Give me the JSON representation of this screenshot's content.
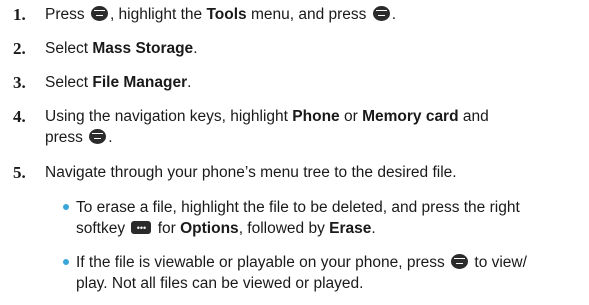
{
  "steps": [
    {
      "num": "1.",
      "a": "Press ",
      "b": ", highlight the ",
      "c": "Tools",
      "d": " menu, and press ",
      "e": "."
    },
    {
      "num": "2.",
      "a": "Select ",
      "b": "Mass Storage",
      "c": "."
    },
    {
      "num": "3.",
      "a": "Select ",
      "b": "File Manager",
      "c": "."
    },
    {
      "num": "4.",
      "a": "Using the navigation keys, highlight ",
      "b": "Phone",
      "c": " or ",
      "d": "Memory card",
      "e": " and",
      "f": "press ",
      "g": "."
    },
    {
      "num": "5.",
      "a": "Navigate through your phone’s menu tree to the desired file."
    }
  ],
  "bullets": [
    {
      "a": "To erase a file, highlight the file to be deleted, and press the right",
      "b": "softkey ",
      "c": " for ",
      "d": "Options",
      "e": ", followed by ",
      "f": "Erase",
      "g": "."
    },
    {
      "a": "If the file is viewable or playable on your phone, press ",
      "b": " to view/",
      "c": "play. Not all files can be viewed or played."
    }
  ],
  "icons": {
    "menu_ok_key": "menu-ok-key-icon",
    "right_softkey": "right-softkey-icon",
    "bullet_color": "#3aa5d8"
  }
}
